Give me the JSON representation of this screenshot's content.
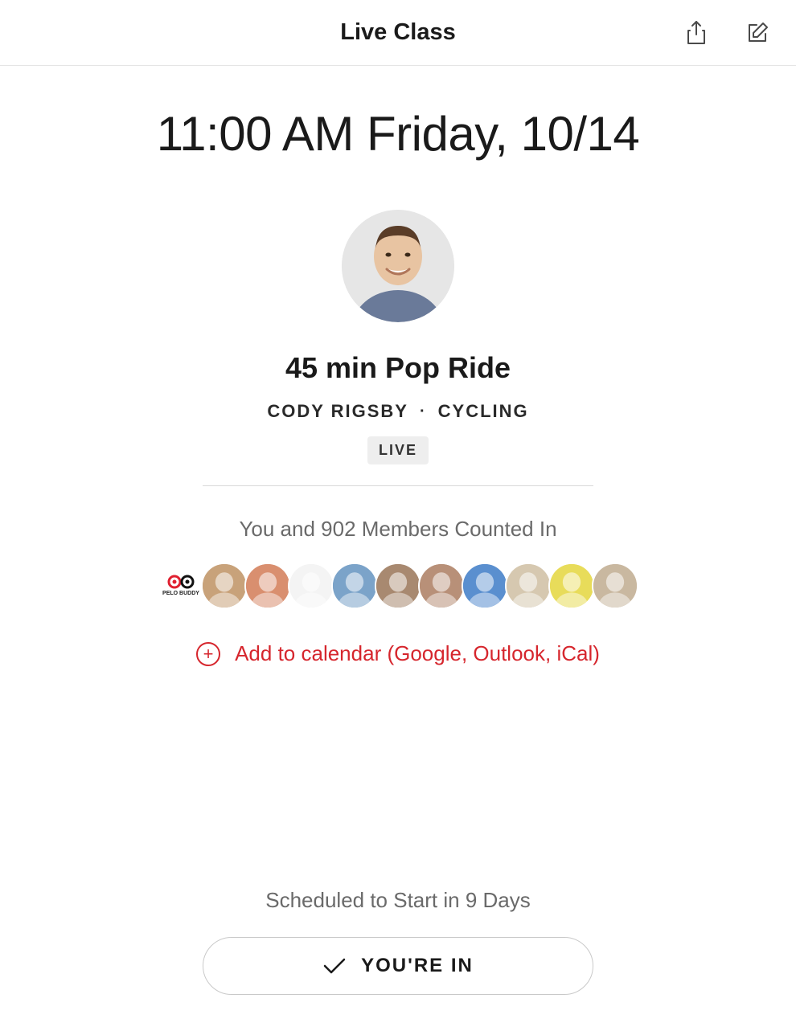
{
  "header": {
    "title": "Live Class"
  },
  "datetime": "11:00 AM Friday, 10/14",
  "class": {
    "title": "45 min Pop Ride",
    "instructor": "CODY RIGSBY",
    "category": "CYCLING",
    "status_badge": "LIVE"
  },
  "counted_in": {
    "text": "You and 902 Members Counted In",
    "member_count": 902,
    "avatars": [
      {
        "name": "pelo-buddy",
        "label": "PELO BUDDY",
        "bg": "#ffffff"
      },
      {
        "name": "member-1",
        "bg": "#c8a27a"
      },
      {
        "name": "member-2",
        "bg": "#d98f6f"
      },
      {
        "name": "member-3",
        "bg": "#f4f4f4"
      },
      {
        "name": "member-4",
        "bg": "#7ba3c9"
      },
      {
        "name": "member-5",
        "bg": "#a88970"
      },
      {
        "name": "member-6",
        "bg": "#b89078"
      },
      {
        "name": "member-7",
        "bg": "#5a8fcf"
      },
      {
        "name": "member-8",
        "bg": "#d6c8b0"
      },
      {
        "name": "member-9",
        "bg": "#e8dc5a"
      },
      {
        "name": "member-10",
        "bg": "#c9b8a0"
      }
    ]
  },
  "add_calendar": {
    "label": "Add to calendar (Google, Outlook, iCal)"
  },
  "footer": {
    "scheduled_text": "Scheduled to Start in 9 Days",
    "button_label": "YOU'RE IN"
  },
  "colors": {
    "accent": "#d6262d"
  }
}
